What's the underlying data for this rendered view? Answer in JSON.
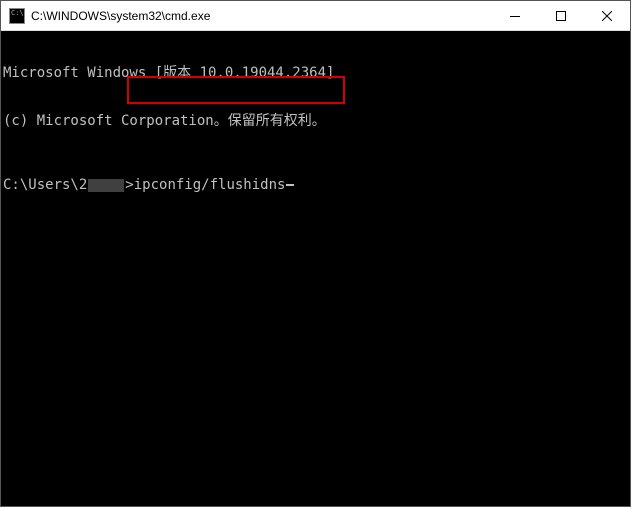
{
  "titlebar": {
    "title": "C:\\WINDOWS\\system32\\cmd.exe"
  },
  "terminal": {
    "line1": "Microsoft Windows [版本 10.0.19044.2364]",
    "line2": "(c) Microsoft Corporation。保留所有权利。",
    "prompt_prefix": "C:\\Users\\2",
    "prompt_suffix": ">",
    "command": "ipconfig/flushidns"
  }
}
